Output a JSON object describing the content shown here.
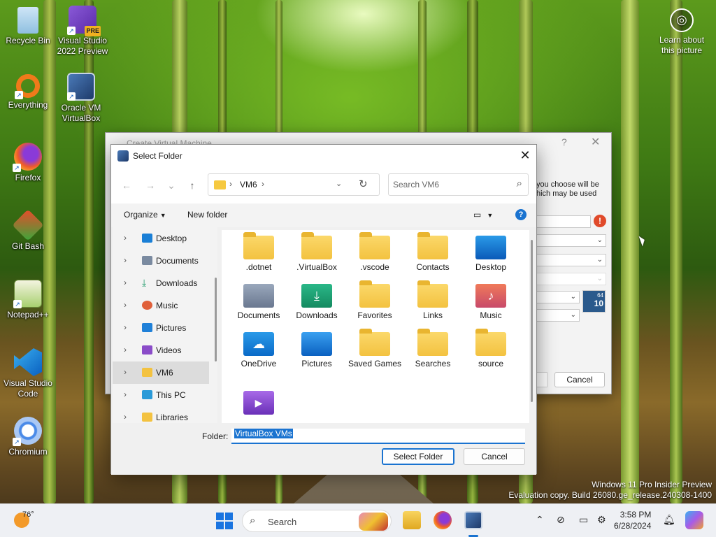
{
  "desktop": {
    "icons": [
      {
        "label": "Recycle Bin"
      },
      {
        "label": "Visual Studio 2022 Preview",
        "badge": "PRE"
      },
      {
        "label": "Everything"
      },
      {
        "label": "Oracle VM VirtualBox"
      },
      {
        "label": "Firefox"
      },
      {
        "label": "Git Bash"
      },
      {
        "label": "Notepad++"
      },
      {
        "label": "Visual Studio Code"
      },
      {
        "label": "Chromium"
      }
    ],
    "learn_about": "Learn about this picture",
    "watermark_line1": "Windows 11 Pro Insider Preview",
    "watermark_line2": "Evaluation copy. Build 26080.ge_release.240308-1400"
  },
  "vm_dialog": {
    "title": "Create Virtual Machine",
    "help_glyph": "?",
    "close_glyph": "✕",
    "desc_line1": "you choose will be",
    "desc_line2": "hich may be used",
    "os_badge_top": "64",
    "os_badge_bottom": "10",
    "cancel_label": "Cancel"
  },
  "select_folder": {
    "title": "Select Folder",
    "close_glyph": "✕",
    "nav": {
      "back": "←",
      "forward": "→",
      "recent": "⌄",
      "up": "↑"
    },
    "breadcrumb": [
      "VM6"
    ],
    "search_placeholder": "Search VM6",
    "organize_label": "Organize",
    "new_folder_label": "New folder",
    "help_glyph": "?",
    "tree": [
      {
        "label": "Desktop",
        "color": "#1a7fd6"
      },
      {
        "label": "Documents",
        "color": "#7a8aa0"
      },
      {
        "label": "Downloads",
        "color": "#1f9a6a"
      },
      {
        "label": "Music",
        "color": "#e0603a"
      },
      {
        "label": "Pictures",
        "color": "#1f80d8"
      },
      {
        "label": "Videos",
        "color": "#8a4cc8"
      },
      {
        "label": "VM6",
        "color": "#f3c240",
        "selected": true
      },
      {
        "label": "This PC",
        "color": "#2a9ad8"
      },
      {
        "label": "Libraries",
        "color": "#f3c240"
      }
    ],
    "files": [
      {
        "label": ".dotnet",
        "kind": "folder"
      },
      {
        "label": ".VirtualBox",
        "kind": "folder"
      },
      {
        "label": ".vscode",
        "kind": "folder"
      },
      {
        "label": "Contacts",
        "kind": "folder"
      },
      {
        "label": "Desktop",
        "kind": "desktop"
      },
      {
        "label": "Documents",
        "kind": "documents"
      },
      {
        "label": "Downloads",
        "kind": "downloads"
      },
      {
        "label": "Favorites",
        "kind": "folder"
      },
      {
        "label": "Links",
        "kind": "folder"
      },
      {
        "label": "Music",
        "kind": "music"
      },
      {
        "label": "OneDrive",
        "kind": "onedrive"
      },
      {
        "label": "Pictures",
        "kind": "pictures"
      },
      {
        "label": "Saved Games",
        "kind": "folder"
      },
      {
        "label": "Searches",
        "kind": "folder"
      },
      {
        "label": "source",
        "kind": "folder"
      },
      {
        "label": "",
        "kind": "videos"
      }
    ],
    "folder_label": "Folder:",
    "folder_value": "VirtualBox VMs",
    "select_button": "Select Folder",
    "cancel_button": "Cancel"
  },
  "taskbar": {
    "temperature": "76°",
    "search_label": "Search",
    "time": "3:58 PM",
    "date": "6/28/2024",
    "tray_icons": [
      "chevron-up-icon",
      "network-icon",
      "display-icon",
      "settings-icon",
      "notification-icon"
    ]
  }
}
